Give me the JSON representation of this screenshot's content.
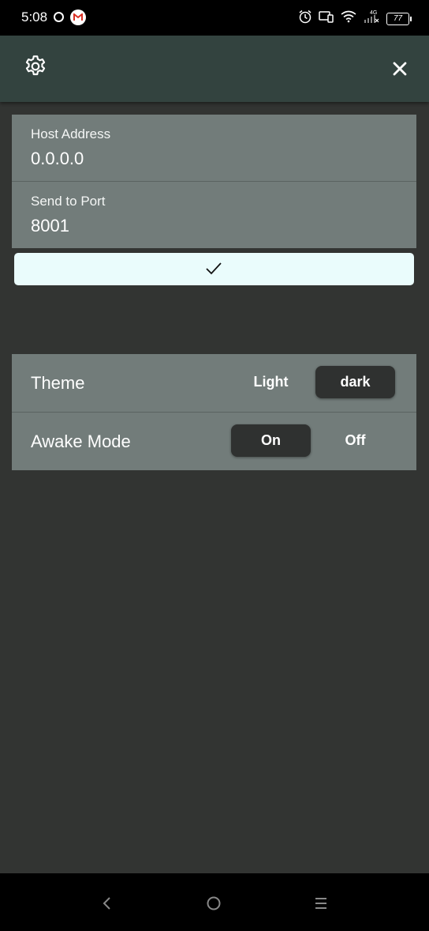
{
  "status_bar": {
    "time": "5:08",
    "battery": "77",
    "icons": [
      "circle-dot-icon",
      "gmail-icon",
      "alarm-icon",
      "devices-icon",
      "wifi-icon",
      "signal-4g-icon",
      "battery-icon"
    ]
  },
  "app_bar": {
    "icons": [
      "gear-icon",
      "close-icon"
    ]
  },
  "connection": {
    "host": {
      "label": "Host Address",
      "value": "0.0.0.0"
    },
    "port": {
      "label": "Send to Port",
      "value": "8001"
    },
    "confirm_icon": "checkmark-icon"
  },
  "settings": {
    "theme": {
      "label": "Theme",
      "options": [
        "Light",
        "dark"
      ],
      "selected": "dark"
    },
    "awake": {
      "label": "Awake Mode",
      "options": [
        "On",
        "Off"
      ],
      "selected": "On"
    }
  },
  "nav_bar": {
    "icons": [
      "back-icon",
      "home-icon",
      "recents-icon"
    ]
  },
  "colors": {
    "background": "#323432",
    "app_bar": "#33433f",
    "card": "#727c7a",
    "confirm_button": "#eafcfc",
    "segment_active": "#2f3130"
  }
}
